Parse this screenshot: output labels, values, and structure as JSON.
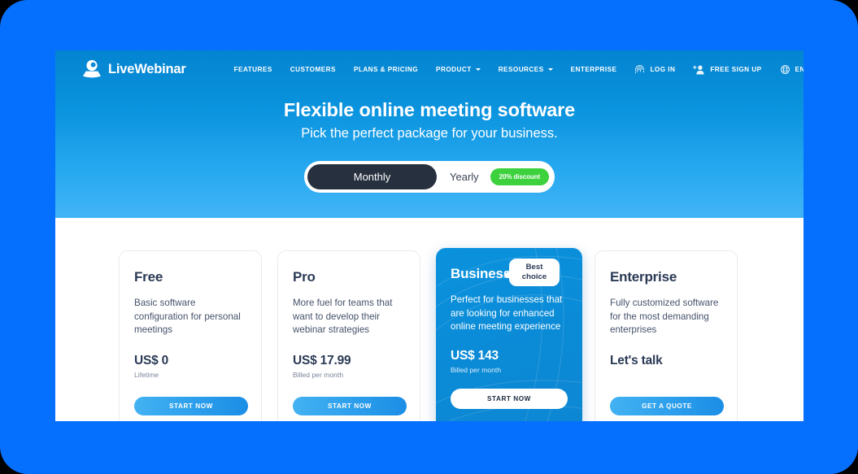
{
  "theme": {
    "frame_blue": "#0670FE",
    "header_top": "#0484d0",
    "header_bottom": "#42b4f6",
    "featured_blue": "#0b8ad6",
    "toggle_dark": "#27303f",
    "discount_green": "#3ed13e",
    "cta_gradient_from": "#42b2f2",
    "cta_gradient_to": "#1b8ee6",
    "heading_ink": "#2b3a55"
  },
  "nav": {
    "brand": "LiveWebinar",
    "links": [
      {
        "label": "FEATURES",
        "has_caret": false
      },
      {
        "label": "CUSTOMERS",
        "has_caret": false
      },
      {
        "label": "PLANS & PRICING",
        "has_caret": false
      },
      {
        "label": "PRODUCT",
        "has_caret": true
      },
      {
        "label": "RESOURCES",
        "has_caret": true
      },
      {
        "label": "ENTERPRISE",
        "has_caret": false
      }
    ],
    "actions": [
      {
        "label": "LOG IN",
        "icon": "fingerprint-icon"
      },
      {
        "label": "FREE SIGN UP",
        "icon": "user-plus-icon"
      },
      {
        "label": "EN",
        "icon": "globe-icon"
      }
    ]
  },
  "hero": {
    "title": "Flexible online meeting software",
    "subtitle": "Pick the perfect package for your business."
  },
  "billing_toggle": {
    "monthly_label": "Monthly",
    "yearly_label": "Yearly",
    "discount_label": "20% discount",
    "selected": "Monthly"
  },
  "plans": [
    {
      "name": "Free",
      "description": "Basic software configuration for personal meetings",
      "price": "US$ 0",
      "price_note": "Lifetime",
      "cta": "START NOW",
      "featured": false
    },
    {
      "name": "Pro",
      "description": "More fuel for teams that want to develop their webinar strategies",
      "price": "US$ 17.99",
      "price_note": "Billed per month",
      "cta": "START NOW",
      "featured": false
    },
    {
      "name": "Business",
      "description": "Perfect for businesses that are looking for enhanced online meeting experience",
      "price": "US$ 143",
      "price_note": "Billed per month",
      "cta": "START NOW",
      "featured": true,
      "badge_line1": "Best",
      "badge_line2": "choice"
    },
    {
      "name": "Enterprise",
      "description": "Fully customized software for the most demanding enterprises",
      "price": "Let's talk",
      "price_note": "",
      "cta": "GET A QUOTE",
      "featured": false
    }
  ]
}
